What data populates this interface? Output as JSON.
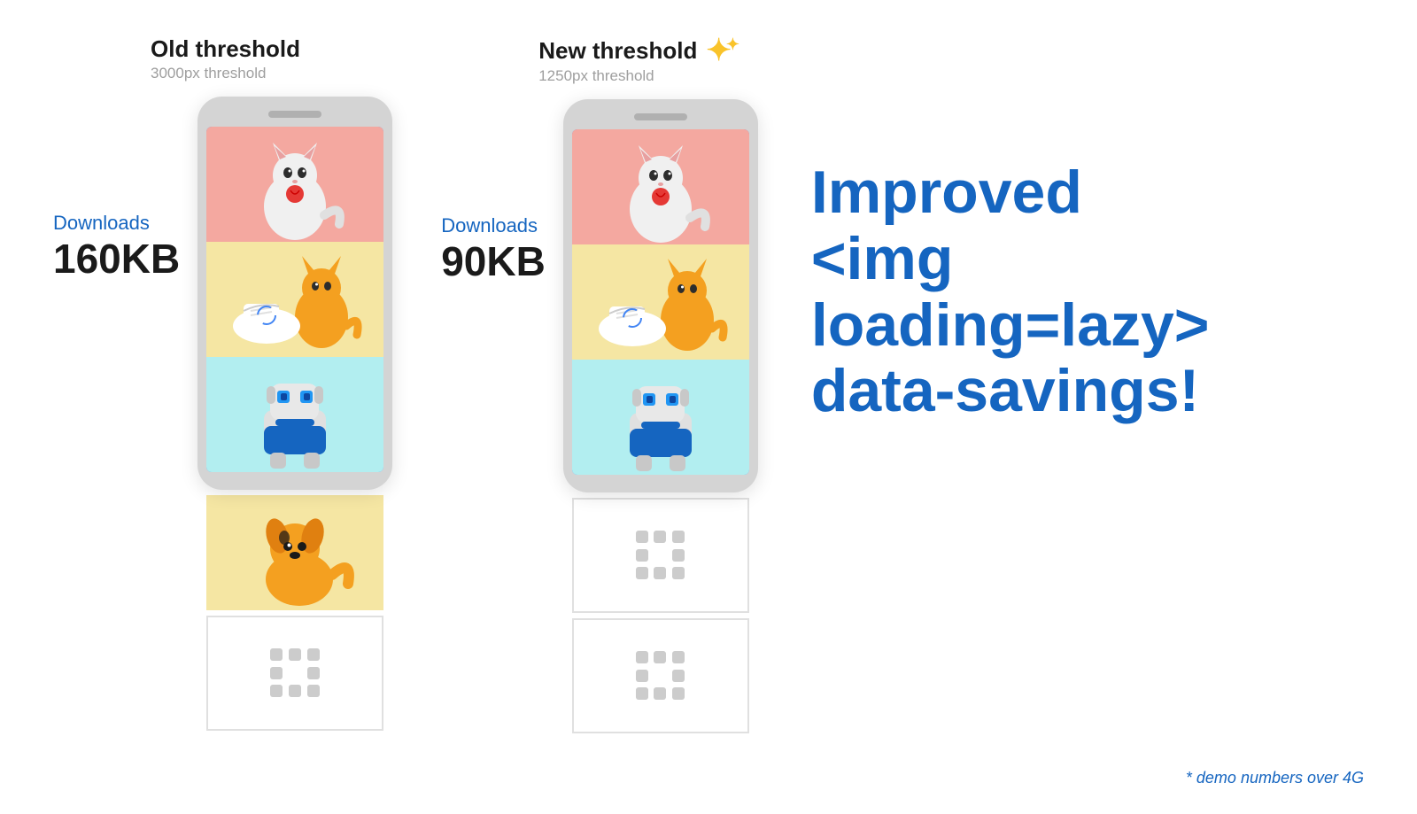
{
  "left_section": {
    "title": "Old threshold",
    "subtitle": "3000px threshold"
  },
  "right_section": {
    "title": "New threshold",
    "subtitle": "1250px threshold",
    "has_sparkle": true
  },
  "left_downloads": {
    "label": "Downloads",
    "size": "160KB"
  },
  "right_downloads": {
    "label": "Downloads",
    "size": "90KB"
  },
  "headline": {
    "line1": "Improved",
    "line2": "<img loading=lazy>",
    "line3": "data-savings!"
  },
  "demo_note": "* demo numbers over 4G",
  "sparkle": "✦",
  "colors": {
    "blue": "#1565C0",
    "yellow": "#f9c32a",
    "text_dark": "#1a1a1a",
    "text_gray": "#9e9e9e"
  }
}
